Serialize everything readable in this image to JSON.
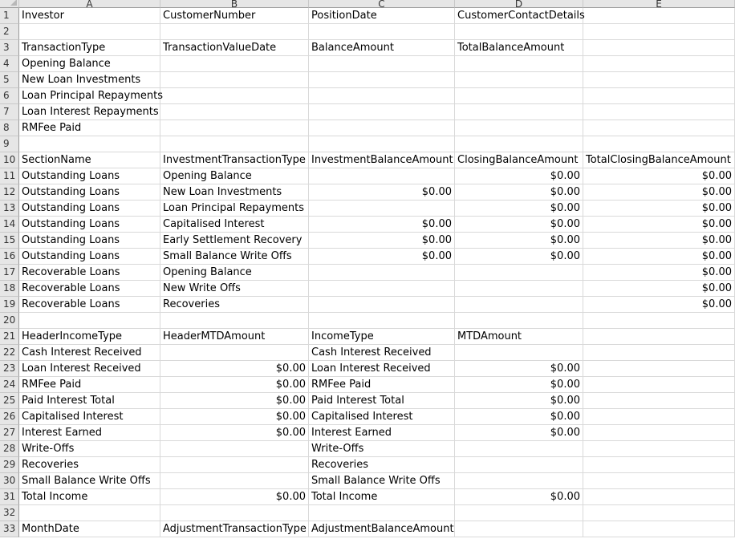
{
  "columns": [
    "A",
    "B",
    "C",
    "D",
    "E"
  ],
  "rows": [
    {
      "n": "1",
      "a": "Investor",
      "b": "CustomerNumber",
      "c": "PositionDate",
      "d": "CustomerContactDetails",
      "e": ""
    },
    {
      "n": "2",
      "a": "",
      "b": "",
      "c": "",
      "d": "",
      "e": ""
    },
    {
      "n": "3",
      "a": "TransactionType",
      "b": "TransactionValueDate",
      "c": "BalanceAmount",
      "d": "TotalBalanceAmount",
      "e": ""
    },
    {
      "n": "4",
      "a": "Opening Balance",
      "b": "",
      "c": "",
      "d": "",
      "e": ""
    },
    {
      "n": "5",
      "a": "New Loan Investments",
      "b": "",
      "c": "",
      "d": "",
      "e": ""
    },
    {
      "n": "6",
      "a": "Loan Principal Repayments",
      "b": "",
      "c": "",
      "d": "",
      "e": ""
    },
    {
      "n": "7",
      "a": "Loan Interest Repayments",
      "b": "",
      "c": "",
      "d": "",
      "e": ""
    },
    {
      "n": "8",
      "a": "RMFee Paid",
      "b": "",
      "c": "",
      "d": "",
      "e": ""
    },
    {
      "n": "9",
      "a": "",
      "b": "",
      "c": "",
      "d": "",
      "e": ""
    },
    {
      "n": "10",
      "a": "SectionName",
      "b": "InvestmentTransactionType",
      "c": "InvestmentBalanceAmount",
      "d": "ClosingBalanceAmount",
      "e": "TotalClosingBalanceAmount"
    },
    {
      "n": "11",
      "a": "Outstanding Loans",
      "b": "Opening Balance",
      "c": "",
      "d": "$0.00",
      "e": "$0.00"
    },
    {
      "n": "12",
      "a": "Outstanding Loans",
      "b": "New Loan Investments",
      "c": "$0.00",
      "d": "$0.00",
      "e": "$0.00"
    },
    {
      "n": "13",
      "a": "Outstanding Loans",
      "b": "Loan Principal Repayments",
      "c": "",
      "d": "$0.00",
      "e": "$0.00"
    },
    {
      "n": "14",
      "a": "Outstanding Loans",
      "b": "Capitalised Interest",
      "c": "$0.00",
      "d": "$0.00",
      "e": "$0.00"
    },
    {
      "n": "15",
      "a": "Outstanding Loans",
      "b": "Early Settlement Recovery",
      "c": "$0.00",
      "d": "$0.00",
      "e": "$0.00"
    },
    {
      "n": "16",
      "a": "Outstanding Loans",
      "b": "Small Balance Write Offs",
      "c": "$0.00",
      "d": "$0.00",
      "e": "$0.00"
    },
    {
      "n": "17",
      "a": "Recoverable Loans",
      "b": "Opening Balance",
      "c": "",
      "d": "",
      "e": "$0.00"
    },
    {
      "n": "18",
      "a": "Recoverable Loans",
      "b": "New Write Offs",
      "c": "",
      "d": "",
      "e": "$0.00"
    },
    {
      "n": "19",
      "a": "Recoverable Loans",
      "b": "Recoveries",
      "c": "",
      "d": "",
      "e": "$0.00"
    },
    {
      "n": "20",
      "a": "",
      "b": "",
      "c": "",
      "d": "",
      "e": ""
    },
    {
      "n": "21",
      "a": "HeaderIncomeType",
      "b": "HeaderMTDAmount",
      "c": "IncomeType",
      "d": "MTDAmount",
      "e": ""
    },
    {
      "n": "22",
      "a": "Cash Interest Received",
      "b": "",
      "c": "Cash Interest Received",
      "d": "",
      "e": ""
    },
    {
      "n": "23",
      "a": "Loan Interest Received",
      "b": "$0.00",
      "c": "Loan Interest Received",
      "d": "$0.00",
      "e": ""
    },
    {
      "n": "24",
      "a": "RMFee Paid",
      "b": "$0.00",
      "c": "RMFee Paid",
      "d": "$0.00",
      "e": ""
    },
    {
      "n": "25",
      "a": "Paid Interest Total",
      "b": "$0.00",
      "c": "Paid Interest Total",
      "d": "$0.00",
      "e": ""
    },
    {
      "n": "26",
      "a": "Capitalised Interest",
      "b": "$0.00",
      "c": "Capitalised Interest",
      "d": "$0.00",
      "e": ""
    },
    {
      "n": "27",
      "a": "Interest Earned",
      "b": "$0.00",
      "c": "Interest Earned",
      "d": "$0.00",
      "e": ""
    },
    {
      "n": "28",
      "a": "Write-Offs",
      "b": "",
      "c": "Write-Offs",
      "d": "",
      "e": ""
    },
    {
      "n": "29",
      "a": "Recoveries",
      "b": "",
      "c": "Recoveries",
      "d": "",
      "e": ""
    },
    {
      "n": "30",
      "a": "Small Balance Write Offs",
      "b": "",
      "c": "Small Balance Write Offs",
      "d": "",
      "e": ""
    },
    {
      "n": "31",
      "a": "Total Income",
      "b": "$0.00",
      "c": "Total Income",
      "d": "$0.00",
      "e": ""
    },
    {
      "n": "32",
      "a": "",
      "b": "",
      "c": "",
      "d": "",
      "e": ""
    },
    {
      "n": "33",
      "a": "MonthDate",
      "b": "AdjustmentTransactionType",
      "c": "AdjustmentBalanceAmount",
      "d": "",
      "e": ""
    }
  ]
}
